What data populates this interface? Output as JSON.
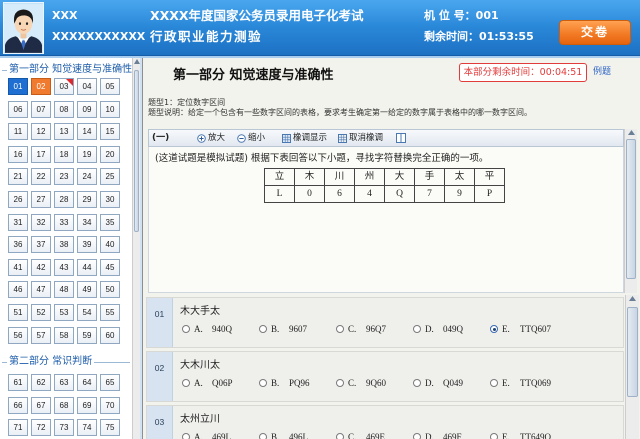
{
  "colors": {
    "header_blue": "#2a88d9",
    "submit_orange": "#f37b26",
    "current_blue": "#1f6fd2",
    "answered_orange": "#f07a2e",
    "flag_red": "#e0262a",
    "timer_red": "#e23b3b",
    "link_blue": "#2c64c6",
    "section_blue": "#1d5caa"
  },
  "header": {
    "avatar_icon": "user-avatar-icon",
    "user_name": "XXX",
    "user_id": "XXXXXXXXXXX",
    "exam_title": "XXXX年度国家公务员录用电子化考试",
    "exam_subject": "行政职业能力测验",
    "seat_label": "机 位 号：",
    "seat_value": "001",
    "time_label": "剩余时间：",
    "time_value": "01:53:55",
    "submit_label": "交卷"
  },
  "sidebar": {
    "sections": [
      {
        "title": "第一部分  知觉速度与准确性",
        "numbers": [
          "01",
          "02",
          "03",
          "04",
          "05",
          "06",
          "07",
          "08",
          "09",
          "10",
          "11",
          "12",
          "13",
          "14",
          "15",
          "16",
          "17",
          "18",
          "19",
          "20",
          "21",
          "22",
          "23",
          "24",
          "25",
          "26",
          "27",
          "28",
          "29",
          "30",
          "31",
          "32",
          "33",
          "34",
          "35",
          "36",
          "37",
          "38",
          "39",
          "40",
          "41",
          "42",
          "43",
          "44",
          "45",
          "46",
          "47",
          "48",
          "49",
          "50",
          "51",
          "52",
          "53",
          "54",
          "55",
          "56",
          "57",
          "58",
          "59",
          "60"
        ],
        "current": "01",
        "answered": [
          "02"
        ],
        "flagged": [
          "03"
        ]
      },
      {
        "title": "第二部分  常识判断",
        "numbers": [
          "61",
          "62",
          "63",
          "64",
          "65",
          "66",
          "67",
          "68",
          "69",
          "70",
          "71",
          "72",
          "73",
          "74",
          "75"
        ],
        "current": null,
        "answered": [],
        "flagged": []
      }
    ]
  },
  "main": {
    "section_title": "第一部分  知觉速度与准确性",
    "section_timer_label": "本部分剩余时间：",
    "section_timer_value": "00:04:51",
    "example_link": "例题",
    "type_title": "题型1：定位数字区间",
    "type_desc": "题型说明：给定一个包含有一些数字区间的表格，要求考生确定第一给定的数字属于表格中的哪一数字区间。",
    "toolbar": {
      "group_label": "(一)",
      "zoom_in_icon": "plus-circle-icon",
      "zoom_in_label": "放大",
      "zoom_out_icon": "minus-circle-icon",
      "zoom_out_label": "缩小",
      "highlight_icon": "grid-icon",
      "highlight_label": "橡调显示",
      "cancel_highlight_icon": "grid-icon",
      "cancel_highlight_label": "取消橡调",
      "layout_icon": "panel-toggle-icon"
    },
    "stem": "(这道试题是模拟试题) 根据下表回答以下小题，寻找字符替换完全正确的一项。",
    "table": {
      "rows": [
        [
          "立",
          "木",
          "川",
          "州",
          "大",
          "手",
          "太",
          "平"
        ],
        [
          "L",
          "0",
          "6",
          "4",
          "Q",
          "7",
          "9",
          "P"
        ]
      ]
    }
  },
  "questions": [
    {
      "num": "01",
      "text": "木大手太",
      "selected": "E.",
      "options": [
        {
          "key": "A.",
          "value": "940Q"
        },
        {
          "key": "B.",
          "value": "9607"
        },
        {
          "key": "C.",
          "value": "96Q7"
        },
        {
          "key": "D.",
          "value": "049Q"
        },
        {
          "key": "E.",
          "value": "TTQ607"
        }
      ]
    },
    {
      "num": "02",
      "text": "大木川太",
      "selected": null,
      "options": [
        {
          "key": "A.",
          "value": "Q06P"
        },
        {
          "key": "B.",
          "value": "PQ96"
        },
        {
          "key": "C.",
          "value": "9Q60"
        },
        {
          "key": "D.",
          "value": "Q049"
        },
        {
          "key": "E.",
          "value": "TTQ069"
        }
      ]
    },
    {
      "num": "03",
      "text": "太州立川",
      "selected": null,
      "options": [
        {
          "key": "A.",
          "value": "469L"
        },
        {
          "key": "B.",
          "value": "496L"
        },
        {
          "key": "C.",
          "value": "469E"
        },
        {
          "key": "D.",
          "value": "469F"
        },
        {
          "key": "E.",
          "value": "TT649Q"
        }
      ]
    }
  ]
}
